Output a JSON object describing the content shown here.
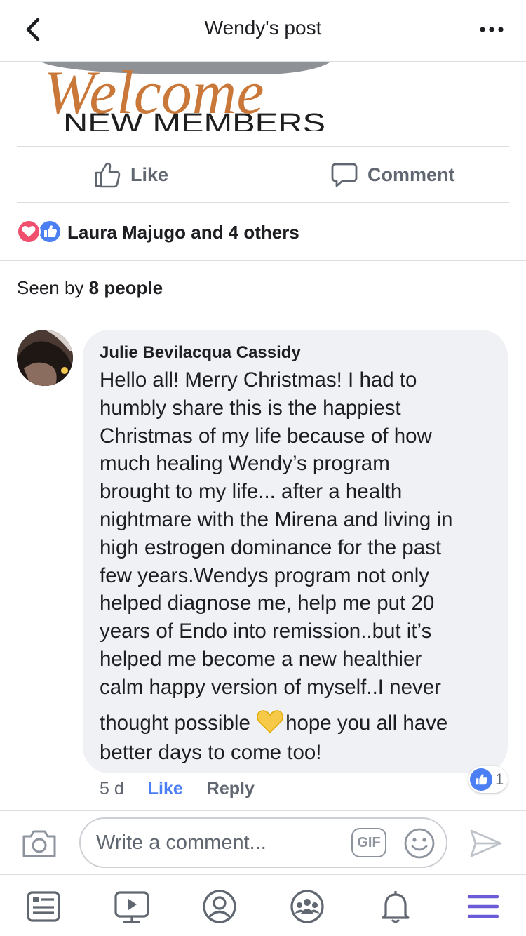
{
  "header": {
    "title": "Wendy's post",
    "back_icon": "chevron-left-icon",
    "more_icon": "more-horizontal-icon"
  },
  "post_image": {
    "welcome_text": "Welcome",
    "subtitle_text": "NEW MEMBERS"
  },
  "actions": {
    "like_label": "Like",
    "comment_label": "Comment"
  },
  "reactions": {
    "summary": "Laura Majugo and 4 others",
    "icons": [
      "love-reaction-icon",
      "like-reaction-icon"
    ]
  },
  "seen": {
    "prefix": "Seen by",
    "count_text": "8 people"
  },
  "comment": {
    "author": "Julie Bevilacqua Cassidy",
    "body_lines": [
      "Hello all! Merry Christmas! I had to",
      "humbly share this is the happiest",
      "Christmas of my life because of how",
      "much healing Wendy’s program",
      "brought to my life... after a health",
      "nightmare with the Mirena and living in",
      "high estrogen dominance for the past",
      "few years.Wendys program not only",
      "helped diagnose me, help me put 20",
      "years of Endo into remission..but it’s",
      "helped me become a new healthier",
      "calm happy version of myself..I never"
    ],
    "line13_before_emoji": "thought possible ",
    "line13_after_emoji": "hope you all have",
    "line14": "better days to come too!",
    "emoji": "yellow-heart-icon",
    "time": "5 d",
    "like_label": "Like",
    "reply_label": "Reply",
    "like_count": "1"
  },
  "composer": {
    "placeholder": "Write a comment...",
    "gif_label": "GIF"
  },
  "colors": {
    "accent_blue": "#4b7ff3",
    "love_red": "#f0506e",
    "nav_active_purple": "#6b5bd6",
    "bubble_bg": "#f0f1f4"
  },
  "nav": {
    "items": [
      "news-feed-icon",
      "watch-icon",
      "profile-icon",
      "groups-icon",
      "notifications-icon",
      "menu-icon"
    ],
    "active": "menu-icon"
  }
}
